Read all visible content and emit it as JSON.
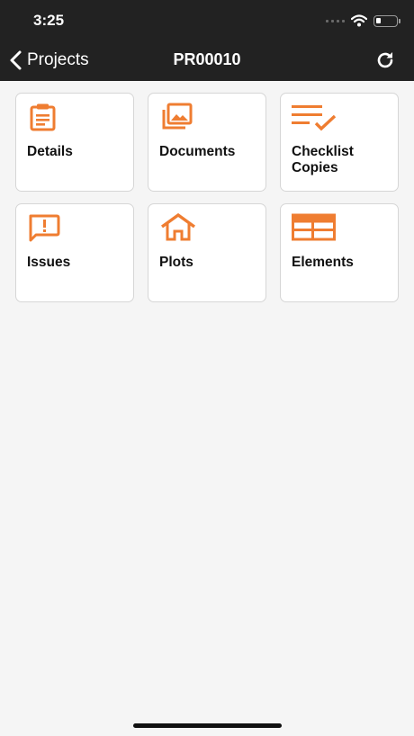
{
  "status_bar": {
    "time": "3:25"
  },
  "header": {
    "back_label": "Projects",
    "title": "PR00010"
  },
  "tiles": [
    {
      "label": "Details",
      "icon": "clipboard-icon"
    },
    {
      "label": "Documents",
      "icon": "photo-library-icon"
    },
    {
      "label": "Checklist Copies",
      "icon": "checklist-icon"
    },
    {
      "label": "Issues",
      "icon": "alert-message-icon"
    },
    {
      "label": "Plots",
      "icon": "house-icon"
    },
    {
      "label": "Elements",
      "icon": "layout-panels-icon"
    }
  ],
  "colors": {
    "header_bg": "#222222",
    "accent": "#ef7d31",
    "page_bg": "#f5f5f5"
  }
}
